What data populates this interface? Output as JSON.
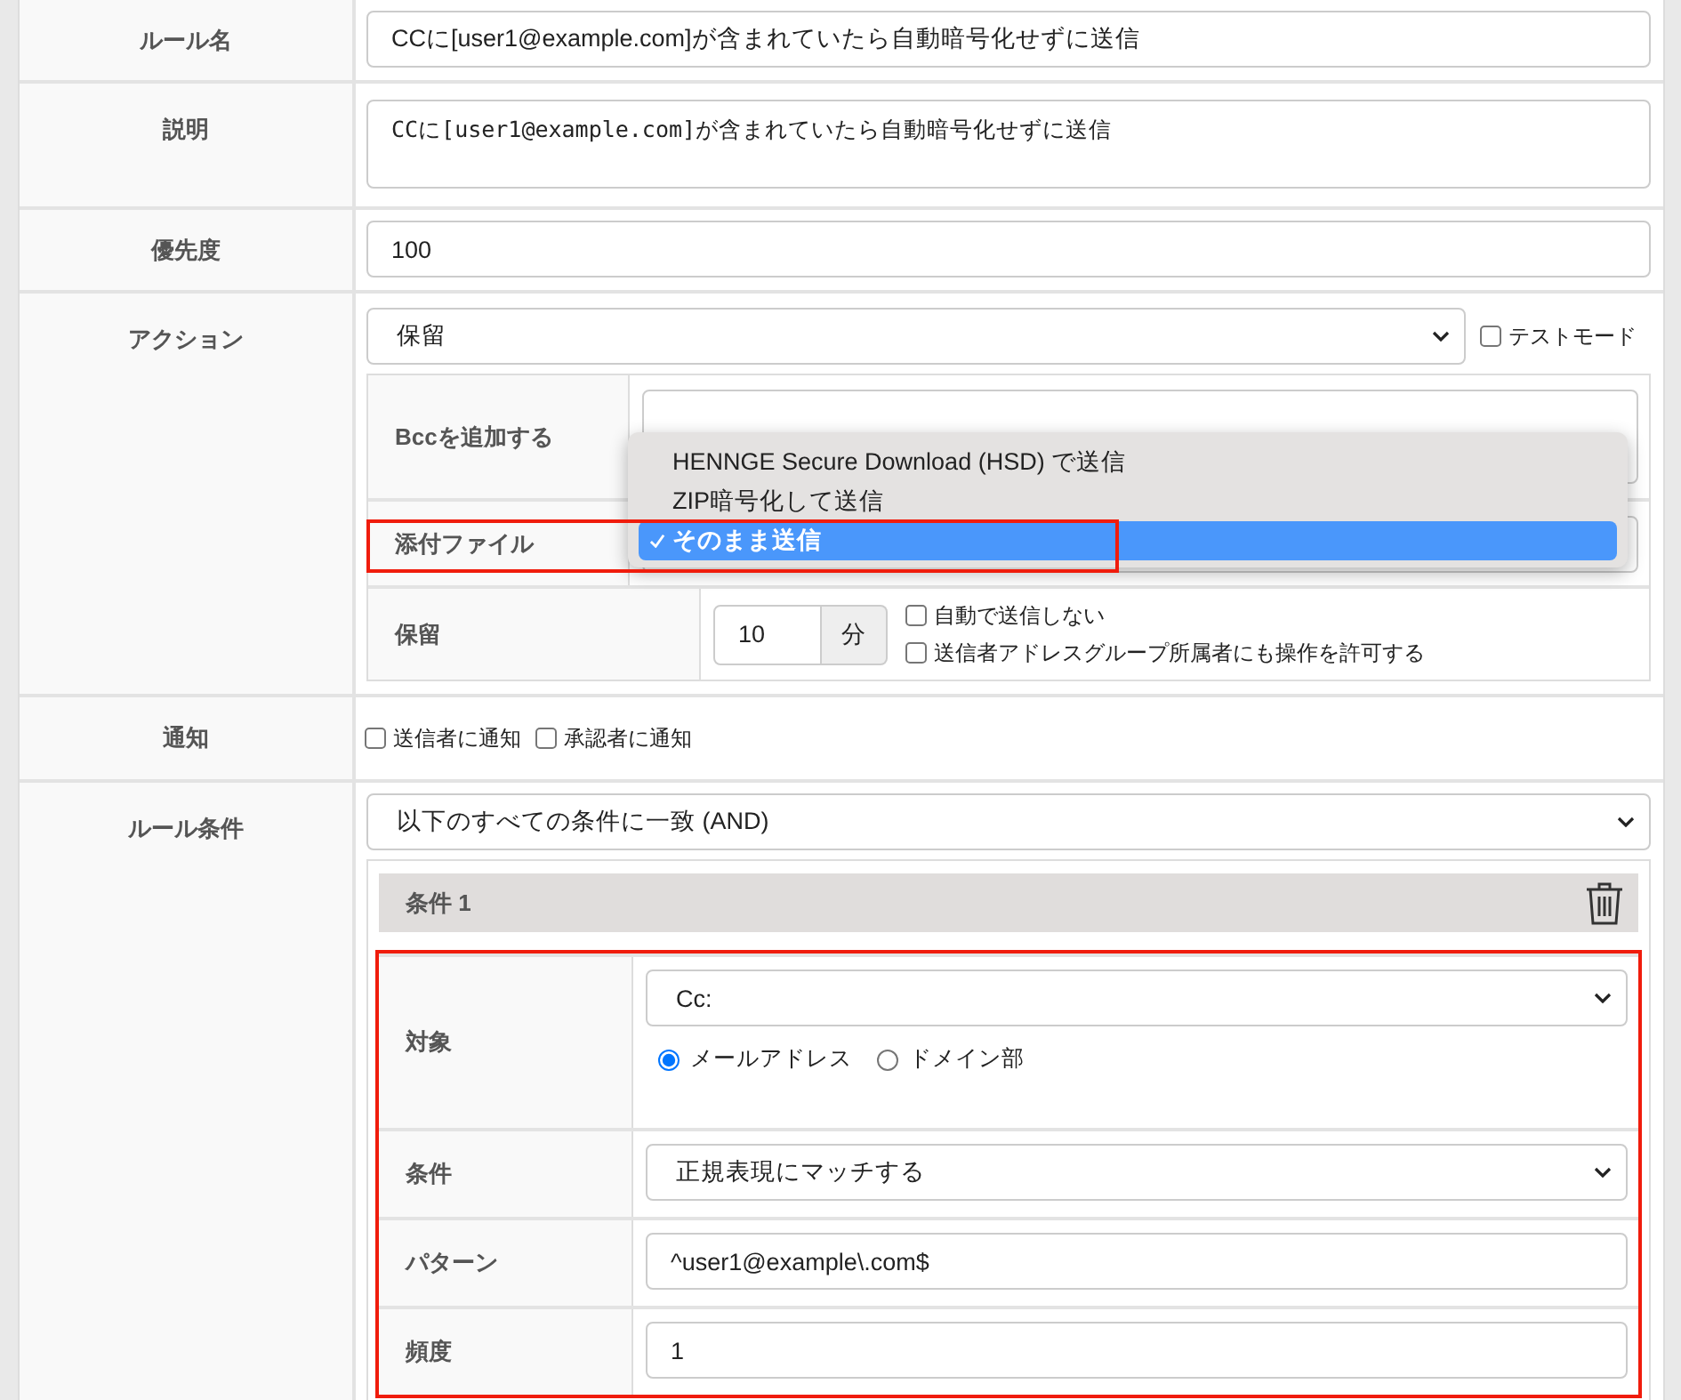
{
  "fields": [
    {
      "label": "ルール名",
      "kind": "input",
      "value": "CCに[user1@example.com]が含まれていたら自動暗号化せずに送信"
    },
    {
      "label": "説明",
      "kind": "textarea",
      "value": "CCに[user1@example.com]が含まれていたら自動暗号化せずに送信"
    },
    {
      "label": "優先度",
      "kind": "input",
      "value": "100"
    }
  ],
  "action": {
    "label": "アクション",
    "select": "保留",
    "test_mode": {
      "label": "テストモード",
      "checked": false
    },
    "bcc": {
      "label": "Bccを追加する"
    },
    "attachment": {
      "label": "添付ファイル",
      "highlighted": true,
      "options": [
        {
          "label": "HENNGE Secure Download (HSD) で送信",
          "selected": false
        },
        {
          "label": "ZIP暗号化して送信",
          "selected": false
        },
        {
          "label": "そのまま送信",
          "selected": true
        }
      ]
    },
    "hold": {
      "label": "保留",
      "value": "10",
      "unit": "分",
      "options": [
        {
          "label": "自動で送信しない",
          "checked": false
        },
        {
          "label": "送信者アドレスグループ所属者にも操作を許可する",
          "checked": false
        }
      ]
    }
  },
  "notify": {
    "label": "通知",
    "options": [
      {
        "label": "送信者に通知",
        "checked": false
      },
      {
        "label": "承認者に通知",
        "checked": false
      }
    ]
  },
  "rule_conditions": {
    "label": "ルール条件",
    "match": "以下のすべての条件に一致 (AND)",
    "conditions": [
      {
        "title": "条件 1",
        "highlighted": true,
        "rows": [
          {
            "label": "対象",
            "kind": "select",
            "value": "Cc:",
            "radios": [
              {
                "label": "メールアドレス",
                "selected": true
              },
              {
                "label": "ドメイン部",
                "selected": false
              }
            ]
          },
          {
            "label": "条件",
            "kind": "select",
            "value": "正規表現にマッチする"
          },
          {
            "label": "パターン",
            "kind": "input",
            "value": "^user1@example\\.com$"
          },
          {
            "label": "頻度",
            "kind": "input",
            "value": "1"
          }
        ]
      }
    ]
  }
}
